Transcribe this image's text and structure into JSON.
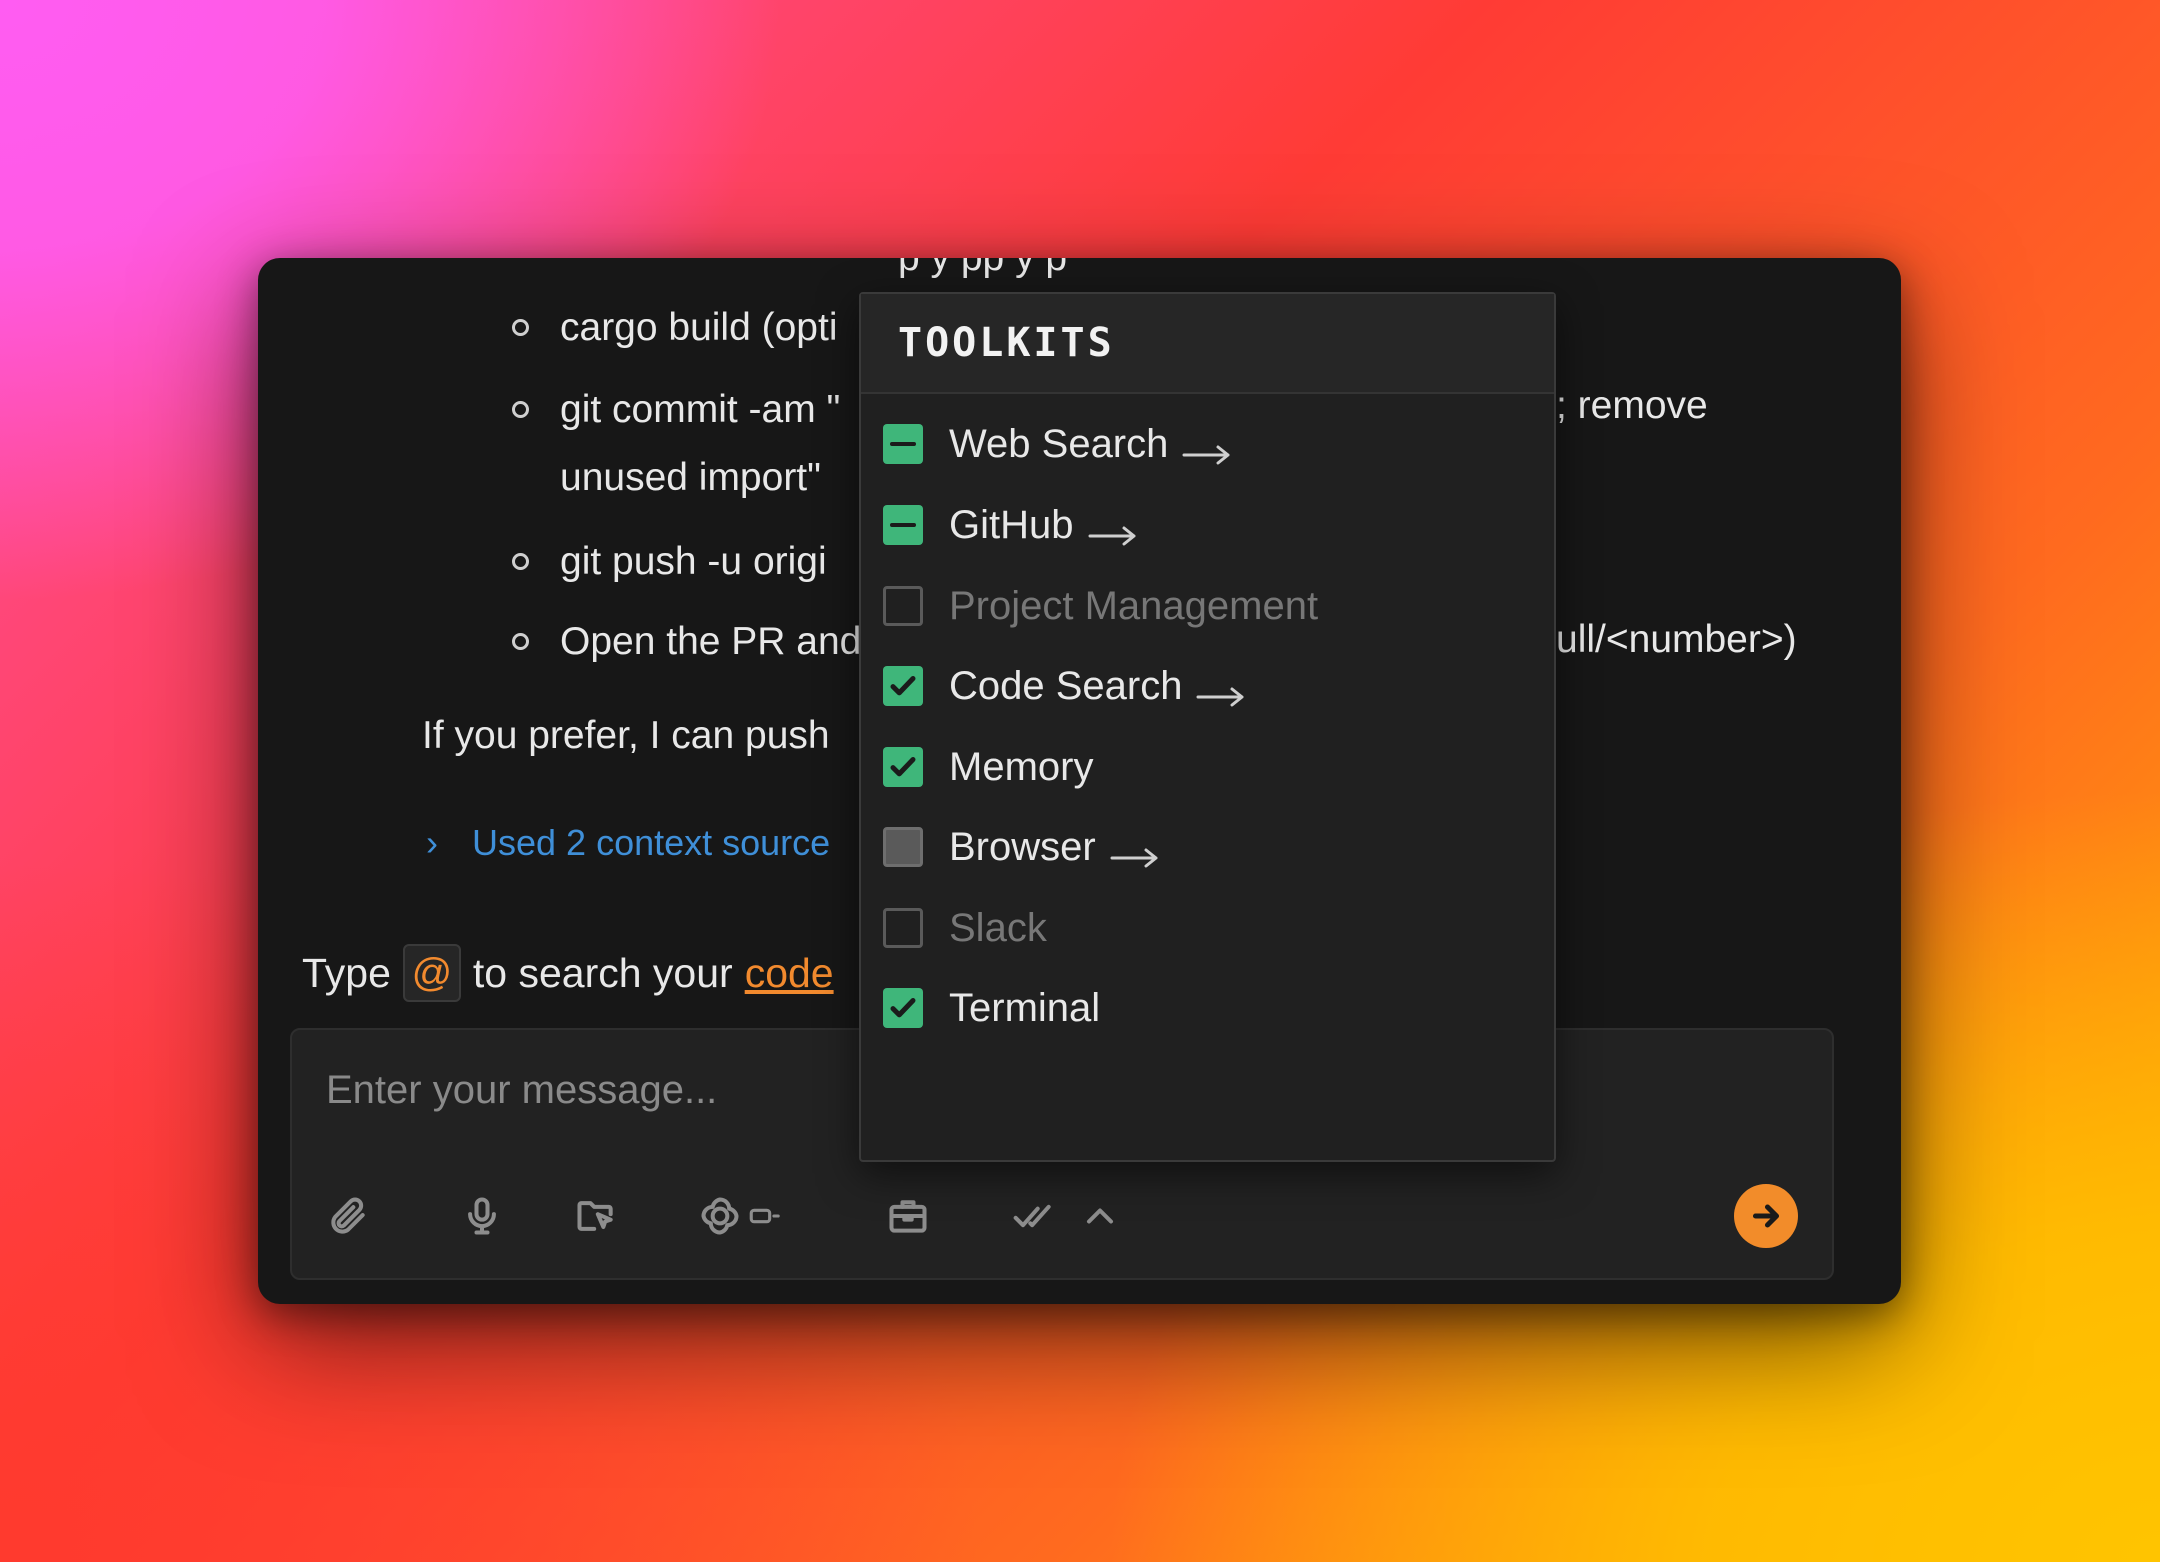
{
  "chat": {
    "cut_top_text": "p                 y  pp y  p",
    "bullets": [
      "cargo build (opti",
      "git commit -am \"",
      "unused import\"",
      "git push -u origi",
      "Open the PR and"
    ],
    "right_texts": {
      "commit_tail": "; remove",
      "pr_tail": "ull/<number>)"
    },
    "paragraph": "If you prefer, I can push",
    "context_sources": "Used 2 context source",
    "context_chevron": "›"
  },
  "hint": {
    "prefix": "Type",
    "at": "@",
    "middle": "to search your",
    "link": "code"
  },
  "composer": {
    "placeholder": "Enter your message...",
    "tools": [
      "paperclip-icon",
      "microphone-icon",
      "folder-cursor-icon",
      "openai-model-icon",
      "briefcase-icon",
      "double-check-icon",
      "chevron-up-icon"
    ],
    "send_icon": "arrow-right-icon",
    "accent": "#f28c2a"
  },
  "toolkits": {
    "title": "TOOLKITS",
    "accent": "#3fb67a",
    "items": [
      {
        "label": "Web Search",
        "state": "partial",
        "arrow": true
      },
      {
        "label": "GitHub",
        "state": "partial",
        "arrow": true
      },
      {
        "label": "Project Management",
        "state": "disabled",
        "arrow": false
      },
      {
        "label": "Code Search",
        "state": "checked",
        "arrow": true
      },
      {
        "label": "Memory",
        "state": "checked",
        "arrow": false
      },
      {
        "label": "Browser",
        "state": "unchecked",
        "arrow": true
      },
      {
        "label": "Slack",
        "state": "disabled",
        "arrow": false
      },
      {
        "label": "Terminal",
        "state": "checked",
        "arrow": false
      }
    ]
  }
}
